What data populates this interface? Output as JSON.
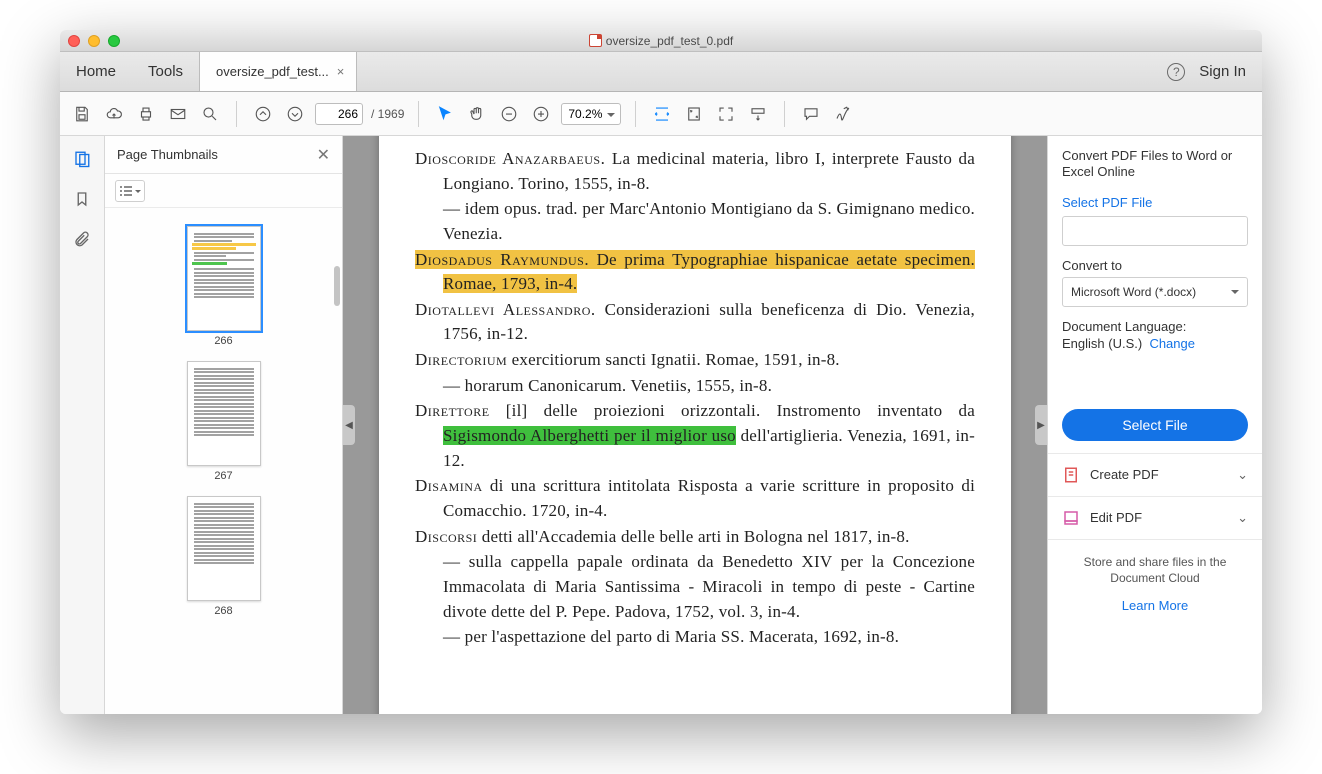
{
  "window": {
    "title": "oversize_pdf_test_0.pdf"
  },
  "tabs": {
    "home": "Home",
    "tools": "Tools",
    "file": "oversize_pdf_test...",
    "sign_in": "Sign In"
  },
  "toolbar": {
    "page_current": "266",
    "page_total": "/  1969",
    "zoom": "70.2%"
  },
  "thumbnails": {
    "title": "Page Thumbnails",
    "items": [
      "266",
      "267",
      "268"
    ]
  },
  "document": {
    "entries": [
      {
        "sc": "Dioscoride Anazarbaeus.",
        "text": " La medicinal materia, libro I, interprete Fausto da Longiano. Torino, 1555, in-8."
      },
      {
        "dash": true,
        "text": "idem opus. trad. per Marc'Antonio Montigiano da S. Gimignano medico. Venezia."
      },
      {
        "sc": "Diosdadus Raymundus.",
        "text": " De prima Typographiae hispanicae aetate specimen. Romae, 1793, in-4.",
        "hl": "yellow"
      },
      {
        "sc": "Diotallevi Alessandro.",
        "text": " Considerazioni sulla beneficenza di Dio. Venezia, 1756, in-12."
      },
      {
        "sc": "Directorium",
        "text": " exercitiorum sancti Ignatii. Romae, 1591, in-8."
      },
      {
        "dash": true,
        "text": "horarum Canonicarum. Venetiis, 1555, in-8."
      },
      {
        "sc": "Direttore",
        "text": " [il] delle proiezioni orizzontali. Instromento inventato da ",
        "hl_part": "Sigismondo Alberghetti per il miglior uso",
        "tail": " dell'artiglieria. Venezia, 1691, in-12."
      },
      {
        "sc": "Disamina",
        "text": " di una scrittura intitolata Risposta a varie scritture in proposito di Comacchio. 1720, in-4."
      },
      {
        "sc": "Discorsi",
        "text": " detti all'Accademia delle belle arti in Bologna nel 1817, in-8."
      },
      {
        "dash": true,
        "text": "sulla cappella papale ordinata da Benedetto XIV per la Concezione Immacolata di Maria Santissima - Miracoli in tempo di peste - Cartine divote dette del P. Pepe. Padova, 1752, vol. 3, in-4."
      },
      {
        "dash": true,
        "text": "per l'aspettazione del parto di Maria SS. Macerata, 1692, in-8."
      }
    ]
  },
  "right": {
    "convert_title": "Convert PDF Files to Word or Excel Online",
    "select_pdf": "Select PDF File",
    "convert_to": "Convert to",
    "convert_format": "Microsoft Word (*.docx)",
    "doc_lang_label": "Document Language:",
    "doc_lang_value": "English (U.S.)",
    "change": "Change",
    "select_file": "Select File",
    "create_pdf": "Create PDF",
    "edit_pdf": "Edit PDF",
    "cloud_msg": "Store and share files in the Document Cloud",
    "learn_more": "Learn More"
  }
}
